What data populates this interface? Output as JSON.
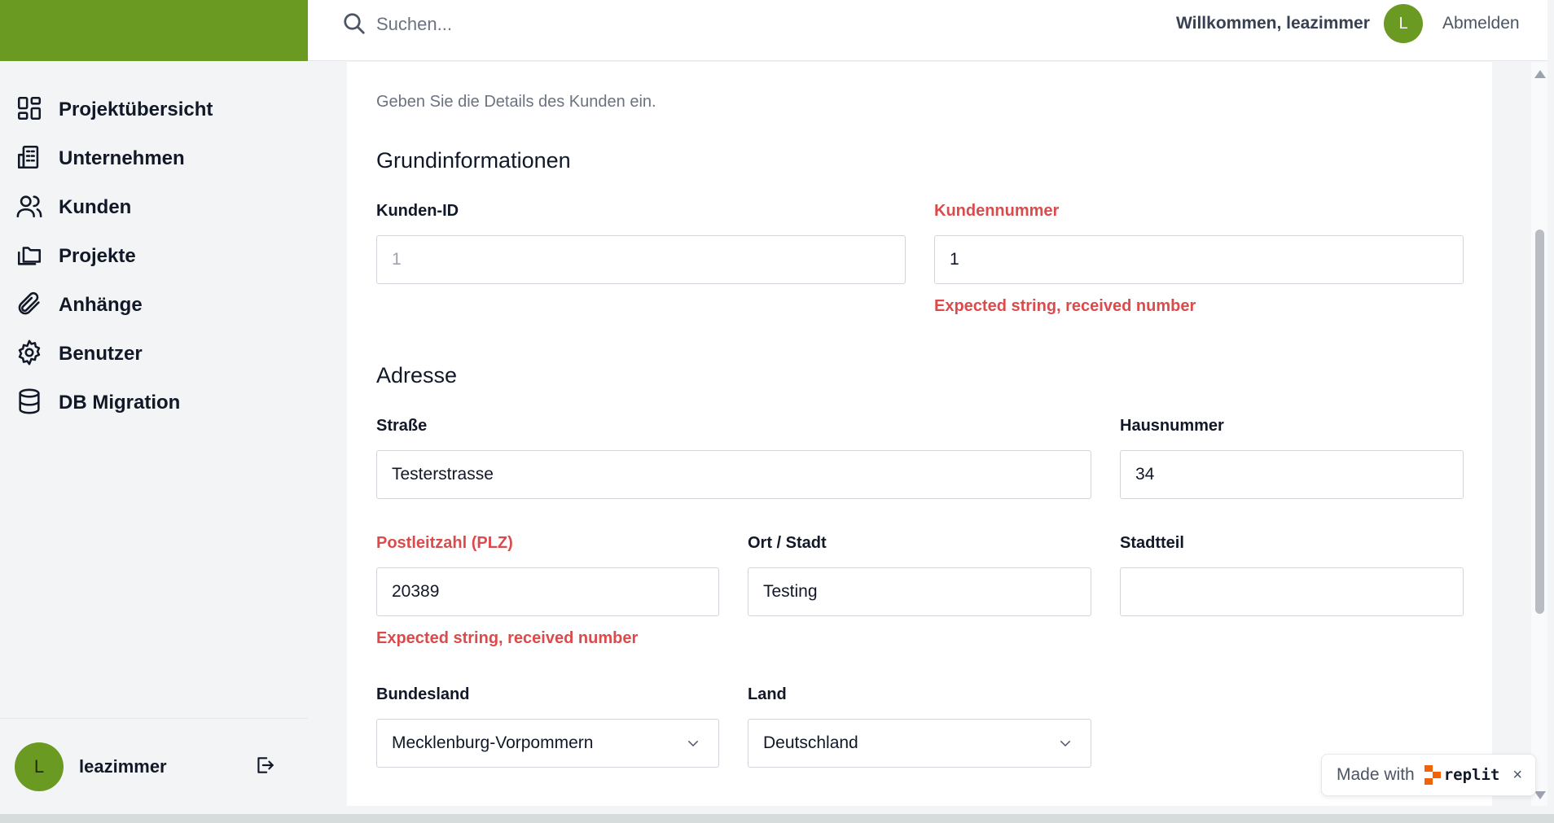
{
  "header": {
    "search_placeholder": "Suchen...",
    "welcome": "Willkommen, leazimmer",
    "avatar_initial": "L",
    "signout": "Abmelden"
  },
  "sidebar": {
    "items": [
      {
        "label": "Projektübersicht",
        "icon": "dashboard-icon"
      },
      {
        "label": "Unternehmen",
        "icon": "building-icon"
      },
      {
        "label": "Kunden",
        "icon": "users-icon"
      },
      {
        "label": "Projekte",
        "icon": "folders-icon"
      },
      {
        "label": "Anhänge",
        "icon": "paperclip-icon"
      },
      {
        "label": "Benutzer",
        "icon": "gear-icon"
      },
      {
        "label": "DB Migration",
        "icon": "database-icon"
      }
    ],
    "footer": {
      "avatar_initial": "L",
      "username": "leazimmer",
      "logout_icon": "logout-icon"
    }
  },
  "form": {
    "intro": "Geben Sie die Details des Kunden ein.",
    "sections": {
      "basic": "Grundinformationen",
      "address": "Adresse"
    },
    "fields": {
      "customer_id": {
        "label": "Kunden-ID",
        "value": "1"
      },
      "customer_number": {
        "label": "Kundennummer",
        "value": "1",
        "error": "Expected string, received number"
      },
      "street": {
        "label": "Straße",
        "value": "Testerstrasse"
      },
      "house_number": {
        "label": "Hausnummer",
        "value": "34"
      },
      "postal_code": {
        "label": "Postleitzahl (PLZ)",
        "value": "20389",
        "error": "Expected string, received number"
      },
      "city": {
        "label": "Ort / Stadt",
        "value": "Testing"
      },
      "district": {
        "label": "Stadtteil",
        "value": ""
      },
      "state": {
        "label": "Bundesland",
        "value": "Mecklenburg-Vorpommern"
      },
      "country": {
        "label": "Land",
        "value": "Deutschland"
      }
    }
  },
  "badge": {
    "text": "Made with",
    "brand": "replit",
    "close": "×"
  },
  "colors": {
    "brand_green": "#6b9a22",
    "error_red": "#dc4b4b"
  }
}
